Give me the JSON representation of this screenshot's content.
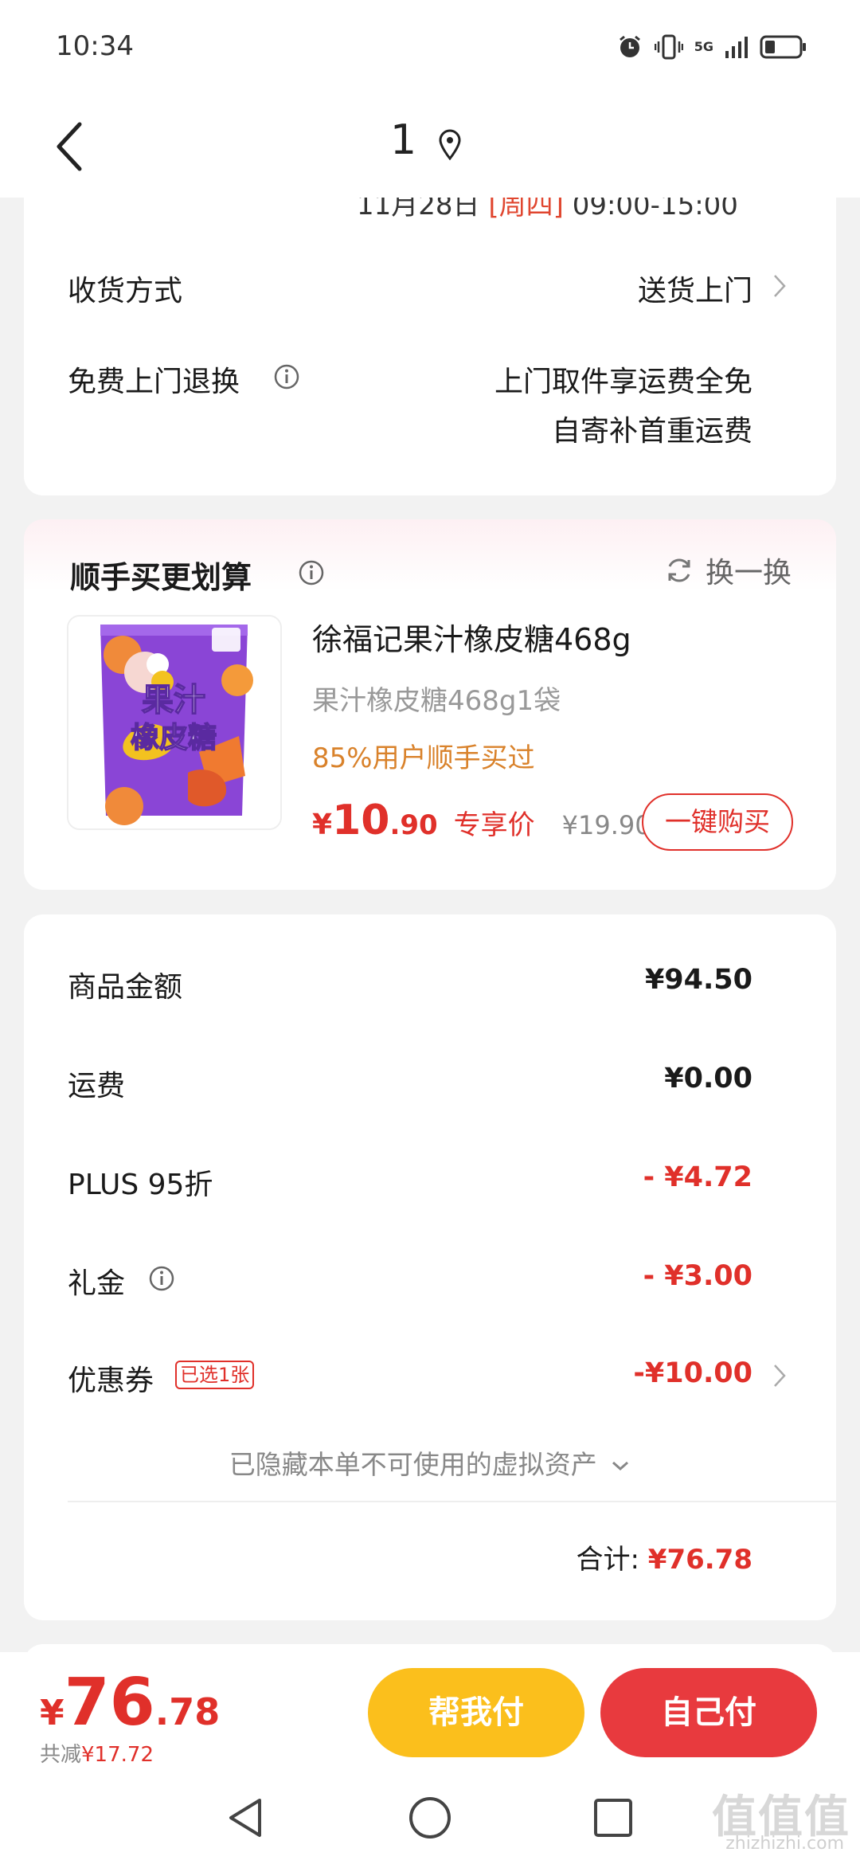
{
  "status_bar": {
    "time": "10:34",
    "network": "5G"
  },
  "nav": {
    "title": "1"
  },
  "delivery_card": {
    "clipped_date": {
      "date": "11月28日",
      "weekday": "[周四]",
      "time_range": "09:00-15:00"
    },
    "method_label": "收货方式",
    "method_value": "送货上门",
    "return_label": "免费上门退换",
    "return_value_line1": "上门取件享运费全免",
    "return_value_line2": "自寄补首重运费"
  },
  "addon_card": {
    "title": "顺手买更划算",
    "swap_label": "换一换",
    "product": {
      "name": "徐福记果汁橡皮糖468g",
      "spec": "果汁橡皮糖468g1袋",
      "tag": "85%用户顺手买过",
      "price_symbol": "¥",
      "price_int": "10",
      "price_dec": ".90",
      "price_label": "专享价",
      "original_price": "¥19.90",
      "buy_label": "一键购买",
      "image_text_line1": "果汁",
      "image_text_line2": "橡皮糖"
    }
  },
  "summary_card": {
    "rows": [
      {
        "label": "商品金额",
        "value": "¥94.50"
      },
      {
        "label": "运费",
        "value": "¥0.00"
      },
      {
        "label": "PLUS 95折",
        "value": "- ¥4.72"
      },
      {
        "label": "礼金",
        "value": "- ¥3.00"
      },
      {
        "label": "优惠券",
        "value": "-¥10.00"
      }
    ],
    "coupon_badge": "已选1张",
    "hidden_note": "已隐藏本单不可使用的虚拟资产",
    "total_label": "合计:",
    "total_value": "¥76.78"
  },
  "bottom_bar": {
    "total_symbol": "¥",
    "total_int": "76",
    "total_dec": ".78",
    "saved_label": "共减",
    "saved_value": "¥17.72",
    "help_pay_label": "帮我付",
    "self_pay_label": "自己付"
  },
  "watermark": {
    "logo": "值值值",
    "url": "zhizhizhi.com"
  },
  "colors": {
    "accent_red": "#e0302a",
    "help_pay_yellow": "#fbbf1c",
    "self_pay_red": "#e83a3e",
    "tag_orange": "#d9822b"
  }
}
